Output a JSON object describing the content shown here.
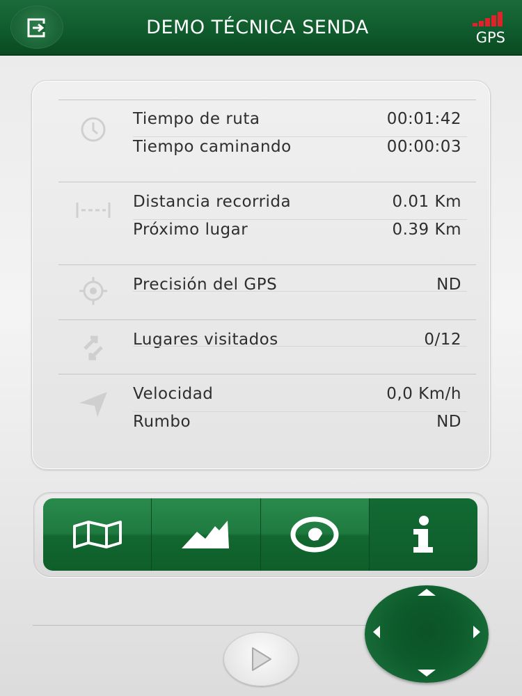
{
  "header": {
    "title": "DEMO TÉCNICA SENDA",
    "exit_icon": "exit-icon",
    "gps_label": "GPS",
    "gps_signal_color": "#e0232b"
  },
  "sections": [
    {
      "icon": "clock-icon",
      "rows": [
        {
          "label": "Tiempo de ruta",
          "value": "00:01:42"
        },
        {
          "label": "Tiempo caminando",
          "value": "00:00:03"
        }
      ]
    },
    {
      "icon": "distance-icon",
      "rows": [
        {
          "label": "Distancia recorrida",
          "value": "0.01 Km"
        },
        {
          "label": "Próximo lugar",
          "value": "0.39 Km"
        }
      ]
    },
    {
      "icon": "crosshair-icon",
      "rows": [
        {
          "label": "Precisión del GPS",
          "value": "ND"
        }
      ]
    },
    {
      "icon": "sync-arrows-icon",
      "rows": [
        {
          "label": "Lugares visitados",
          "value": "0/12"
        }
      ]
    },
    {
      "icon": "navigation-arrow-icon",
      "rows": [
        {
          "label": "Velocidad",
          "value": "0,0 Km/h"
        },
        {
          "label": "Rumbo",
          "value": "ND"
        }
      ]
    }
  ],
  "tabs": [
    {
      "icon": "map-icon",
      "active": false
    },
    {
      "icon": "elevation-profile-icon",
      "active": false
    },
    {
      "icon": "compass-target-icon",
      "active": false
    },
    {
      "icon": "info-icon",
      "active": true
    }
  ],
  "controls": {
    "play_icon": "play-icon",
    "dpad_icon": "dpad-arrows-icon"
  },
  "colors": {
    "brand_green": "#0f5e2a",
    "panel_background": "#e9e9e9"
  }
}
